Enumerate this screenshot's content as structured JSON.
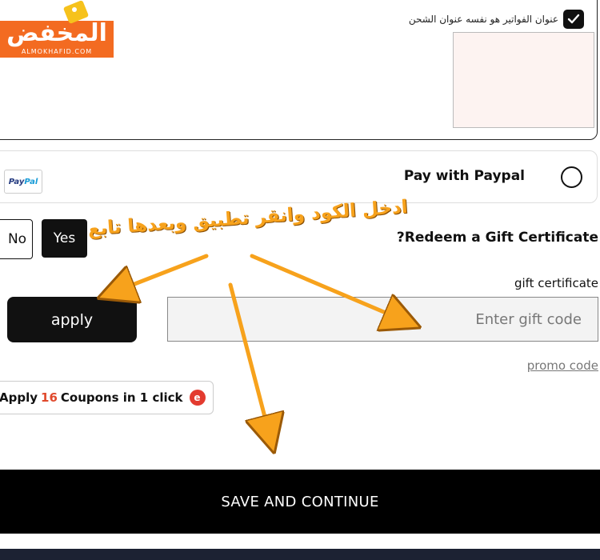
{
  "logo": {
    "text": "المخفض",
    "sub": "ALMOKHAFID.COM"
  },
  "billing": {
    "same_address_label": "عنوان الفواتير هو نفسه عنوان الشحن",
    "same_address_checked": true
  },
  "payment": {
    "paypal_logo_a": "Pay",
    "paypal_logo_b": "Pal",
    "paypal_label": "Pay with Paypal"
  },
  "gift": {
    "no_label": "No",
    "yes_label": "Yes",
    "redeem_label": "?Redeem a Gift Certificate",
    "field_label": "gift certificate",
    "placeholder": "Enter gift code",
    "apply_label": "apply",
    "promo_link": "promo code"
  },
  "coupons": {
    "prefix": "Apply",
    "count": "16",
    "suffix": "Coupons in 1 click",
    "icon_glyph": "e"
  },
  "actions": {
    "save_label": "SAVE AND CONTINUE"
  },
  "annotation": {
    "text": "ادخل الكود وانقر تطبيق وبعدها تابع",
    "color": "#f7a21c"
  },
  "colors": {
    "brand": "#f36b21",
    "accent_dark": "#111111"
  }
}
